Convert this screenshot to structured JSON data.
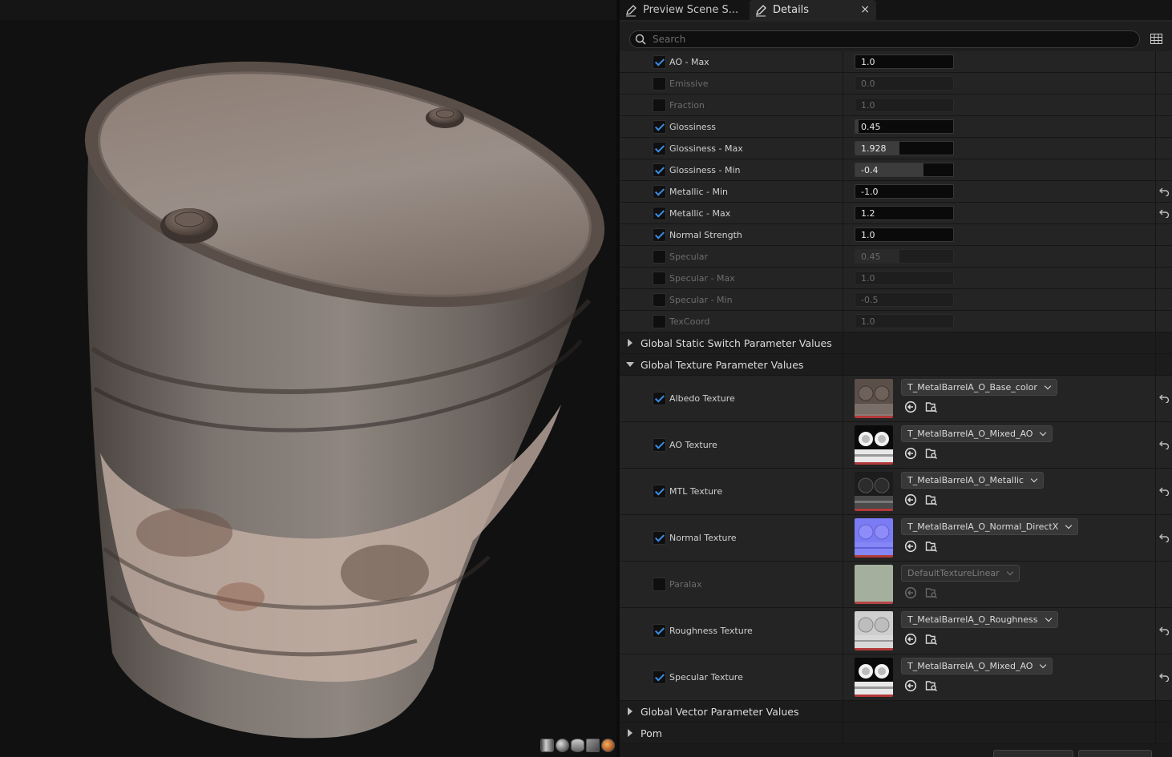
{
  "tabs": {
    "preview": "Preview Scene S...",
    "details": "Details",
    "close": "×"
  },
  "search": {
    "placeholder": "Search",
    "value": ""
  },
  "scalar_rows": [
    {
      "label": "AO - Max",
      "checked": true,
      "value": "1.0",
      "fill": 0.0,
      "reset": false
    },
    {
      "label": "Emissive",
      "checked": false,
      "value": "0.0",
      "fill": 0.0,
      "reset": false
    },
    {
      "label": "Fraction",
      "checked": false,
      "value": "1.0",
      "fill": 0.0,
      "reset": false
    },
    {
      "label": "Glossiness",
      "checked": true,
      "value": "0.45",
      "fill": 0.03,
      "reset": false
    },
    {
      "label": "Glossiness - Max",
      "checked": true,
      "value": "1.928",
      "fill": 0.45,
      "reset": false
    },
    {
      "label": "Glossiness - Min",
      "checked": true,
      "value": "-0.4",
      "fill": 0.7,
      "reset": false
    },
    {
      "label": "Metallic -  Min",
      "checked": true,
      "value": "-1.0",
      "fill": 0.0,
      "reset": true
    },
    {
      "label": "Metallic - Max",
      "checked": true,
      "value": "1.2",
      "fill": 0.0,
      "reset": true
    },
    {
      "label": "Normal Strength",
      "checked": true,
      "value": "1.0",
      "fill": 0.0,
      "reset": false
    },
    {
      "label": "Specular",
      "checked": false,
      "value": "0.45",
      "fill": 0.45,
      "reset": false
    },
    {
      "label": "Specular  - Max",
      "checked": false,
      "value": "1.0",
      "fill": 0.0,
      "reset": false
    },
    {
      "label": "Specular - Min",
      "checked": false,
      "value": "-0.5",
      "fill": 0.0,
      "reset": false
    },
    {
      "label": "TexCoord",
      "checked": false,
      "value": "1.0",
      "fill": 0.0,
      "reset": false
    }
  ],
  "groups": {
    "static_switch": "Global Static Switch Parameter Values",
    "texture": "Global Texture Parameter Values",
    "vector": "Global Vector Parameter Values",
    "pom": "Pom"
  },
  "texture_rows": [
    {
      "label": "Albedo Texture",
      "checked": true,
      "asset": "T_MetalBarrelA_O_Base_color",
      "thumb": "albedo",
      "reset": true
    },
    {
      "label": "AO Texture",
      "checked": true,
      "asset": "T_MetalBarrelA_O_Mixed_AO",
      "thumb": "ao",
      "reset": true
    },
    {
      "label": "MTL Texture",
      "checked": true,
      "asset": "T_MetalBarrelA_O_Metallic",
      "thumb": "metallic",
      "reset": true
    },
    {
      "label": "Normal Texture",
      "checked": true,
      "asset": "T_MetalBarrelA_O_Normal_DirectX",
      "thumb": "normal",
      "reset": true
    },
    {
      "label": "Paralax",
      "checked": false,
      "asset": "DefaultTextureLinear",
      "thumb": "default",
      "reset": false
    },
    {
      "label": "Roughness Texture",
      "checked": true,
      "asset": "T_MetalBarrelA_O_Roughness",
      "thumb": "roughness",
      "reset": true
    },
    {
      "label": "Specular Texture",
      "checked": true,
      "asset": "T_MetalBarrelA_O_Mixed_AO",
      "thumb": "ao",
      "reset": true
    }
  ],
  "colors": {
    "accent": "#3a8ee6",
    "panel": "#242424",
    "viewport_bg": "#e6e6e7"
  }
}
